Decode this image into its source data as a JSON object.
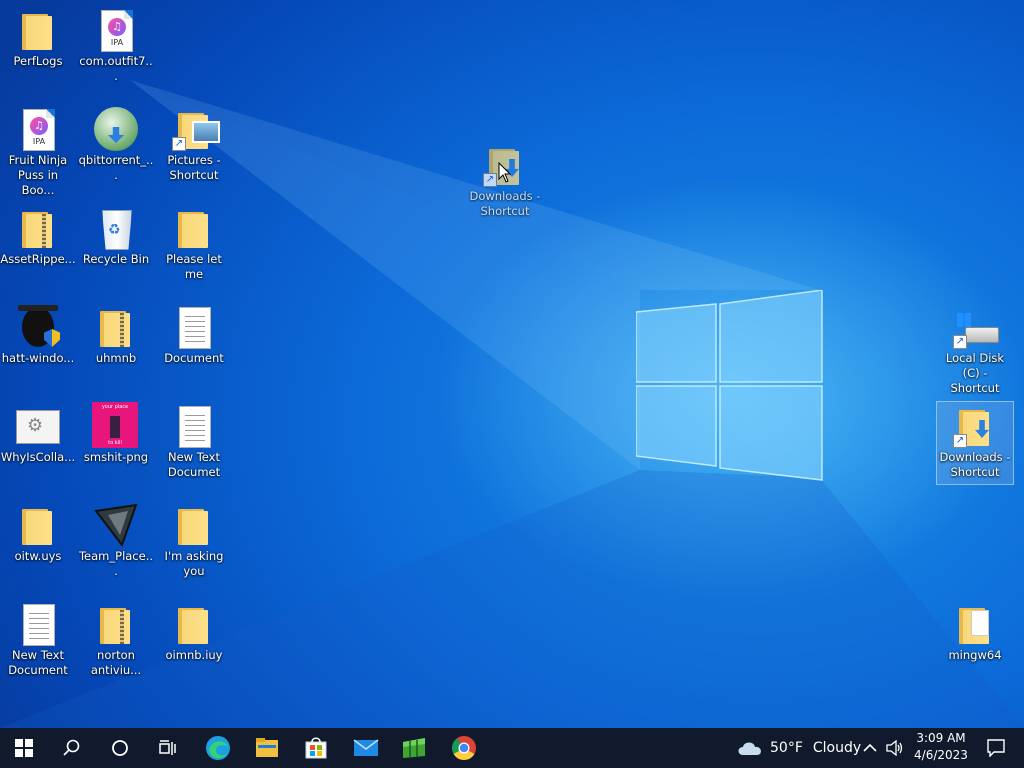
{
  "desktop": {
    "icons": [
      {
        "label": "PerfLogs"
      },
      {
        "label": "com.outfit7..."
      },
      {
        "label": "Fruit Ninja Puss in Boo..."
      },
      {
        "label": "qbittorrent_..."
      },
      {
        "label": "Pictures - Shortcut"
      },
      {
        "label": "AssetRippe..."
      },
      {
        "label": "Recycle Bin"
      },
      {
        "label": "Please let me"
      },
      {
        "label": "hatt-windo..."
      },
      {
        "label": "uhmnb"
      },
      {
        "label": "Document"
      },
      {
        "label": "WhyIsColla..."
      },
      {
        "label": "smshit-png"
      },
      {
        "label": "New Text Documet"
      },
      {
        "label": "oitw.uys"
      },
      {
        "label": "Team_Place..."
      },
      {
        "label": "I'm  asking you"
      },
      {
        "label": "New Text Document"
      },
      {
        "label": "norton antiviu..."
      },
      {
        "label": "oimnb.iuy"
      },
      {
        "label": "Downloads - Shortcut"
      },
      {
        "label": "Local Disk (C) - Shortcut"
      },
      {
        "label": "Downloads - Shortcut"
      },
      {
        "label": "mingw64"
      }
    ],
    "ipa_badge": "IPA",
    "smshit_top": "your place",
    "smshit_bottom": "to kill"
  },
  "taskbar": {
    "weather_temp": "50°F",
    "weather_desc": "Cloudy",
    "time": "3:09 AM",
    "date": "4/6/2023",
    "icons": [
      "windows-start-icon",
      "search-icon",
      "cortana-icon",
      "task-view-icon",
      "edge-icon",
      "file-explorer-icon",
      "microsoft-store-icon",
      "mail-icon",
      "minecraft-icon",
      "chrome-icon"
    ]
  },
  "colors": {
    "taskbar": "#101a2c",
    "accent": "#1473d8"
  }
}
